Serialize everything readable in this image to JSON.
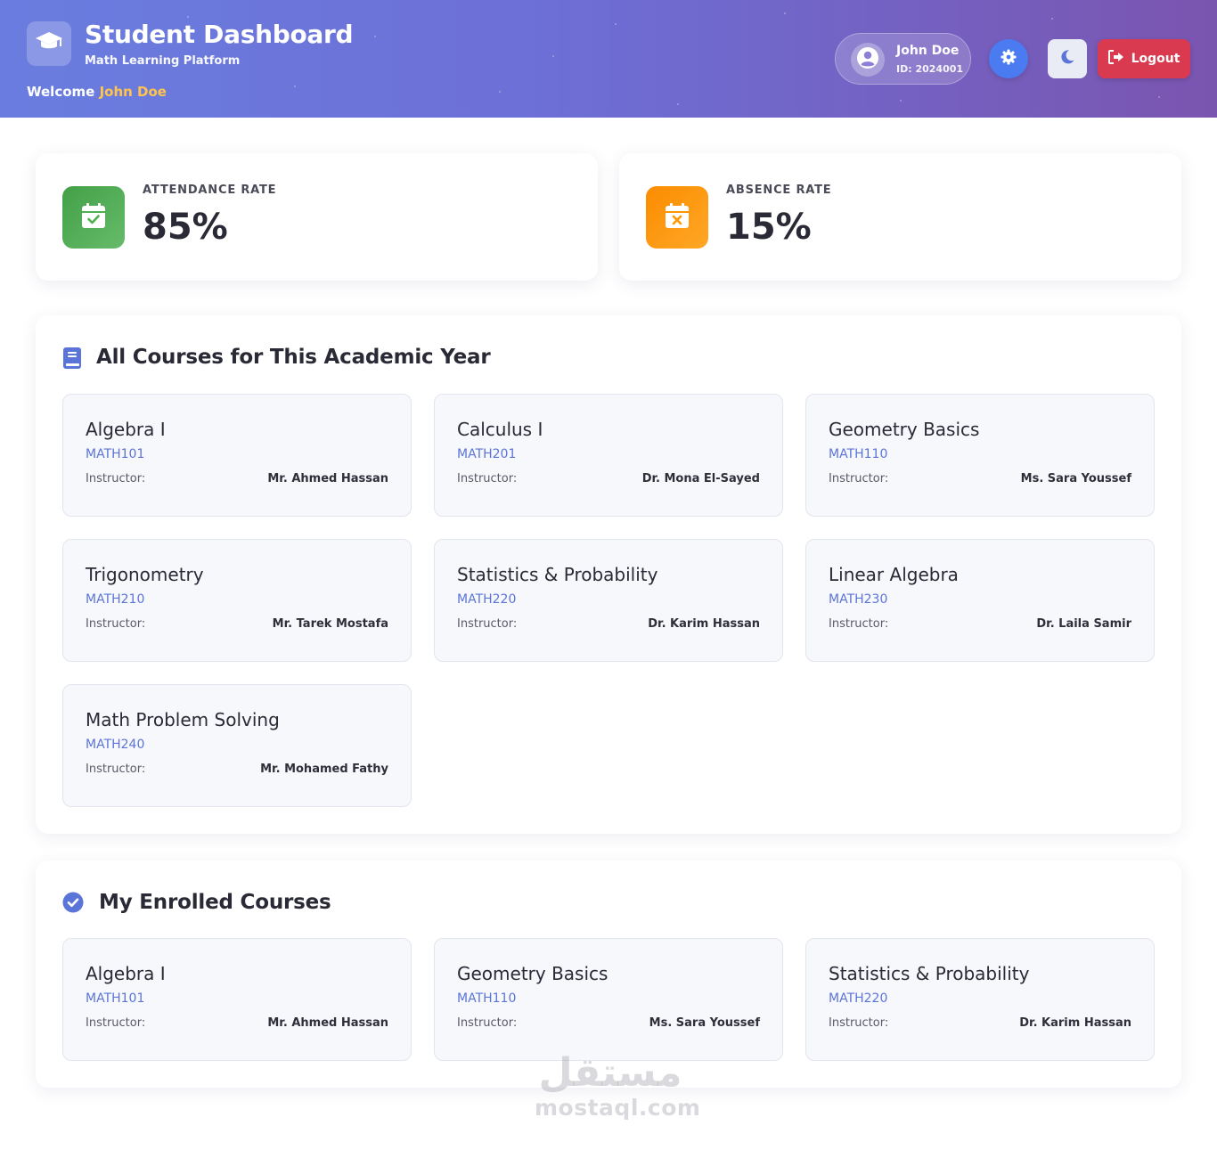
{
  "header": {
    "title": "Student Dashboard",
    "subtitle": "Math Learning Platform",
    "welcome_prefix": "Welcome",
    "welcome_name": "John Doe",
    "logo_icon": "graduation-cap-icon"
  },
  "user": {
    "name": "John Doe",
    "id_text": "ID: 2024001",
    "avatar_icon": "user-circle-icon"
  },
  "controls": {
    "settings_icon": "gear-icon",
    "theme_icon": "moon-icon",
    "logout_label": "Logout",
    "logout_icon": "sign-out-icon"
  },
  "stats": {
    "attendance": {
      "label": "ATTENDANCE RATE",
      "value": "85%",
      "color": "#4caf50",
      "icon": "calendar-check-icon"
    },
    "absence": {
      "label": "ABSENCE RATE",
      "value": "15%",
      "color": "#ff9800",
      "icon": "calendar-x-icon"
    }
  },
  "all_courses": {
    "title": "All Courses for This Academic Year",
    "icon": "book-icon",
    "instructor_label": "Instructor:",
    "items": [
      {
        "name": "Algebra I",
        "code": "MATH101",
        "instructor": "Mr. Ahmed Hassan"
      },
      {
        "name": "Calculus I",
        "code": "MATH201",
        "instructor": "Dr. Mona El-Sayed"
      },
      {
        "name": "Geometry Basics",
        "code": "MATH110",
        "instructor": "Ms. Sara Youssef"
      },
      {
        "name": "Trigonometry",
        "code": "MATH210",
        "instructor": "Mr. Tarek Mostafa"
      },
      {
        "name": "Statistics & Probability",
        "code": "MATH220",
        "instructor": "Dr. Karim Hassan"
      },
      {
        "name": "Linear Algebra",
        "code": "MATH230",
        "instructor": "Dr. Laila Samir"
      },
      {
        "name": "Math Problem Solving",
        "code": "MATH240",
        "instructor": "Mr. Mohamed Fathy"
      }
    ]
  },
  "enrolled_courses": {
    "title": "My Enrolled Courses",
    "icon": "check-circle-icon",
    "instructor_label": "Instructor:",
    "items": [
      {
        "name": "Algebra I",
        "code": "MATH101",
        "instructor": "Mr. Ahmed Hassan"
      },
      {
        "name": "Geometry Basics",
        "code": "MATH110",
        "instructor": "Ms. Sara Youssef"
      },
      {
        "name": "Statistics & Probability",
        "code": "MATH220",
        "instructor": "Dr. Karim Hassan"
      }
    ]
  },
  "watermark": {
    "arabic": "مستقل",
    "latin": "mostaql.com"
  },
  "colors": {
    "accent": "#5b74d8",
    "header_start": "#6a7ddf",
    "header_end": "#7a55b0",
    "logout": "#d93a50",
    "welcome_name": "#ffc44d"
  }
}
